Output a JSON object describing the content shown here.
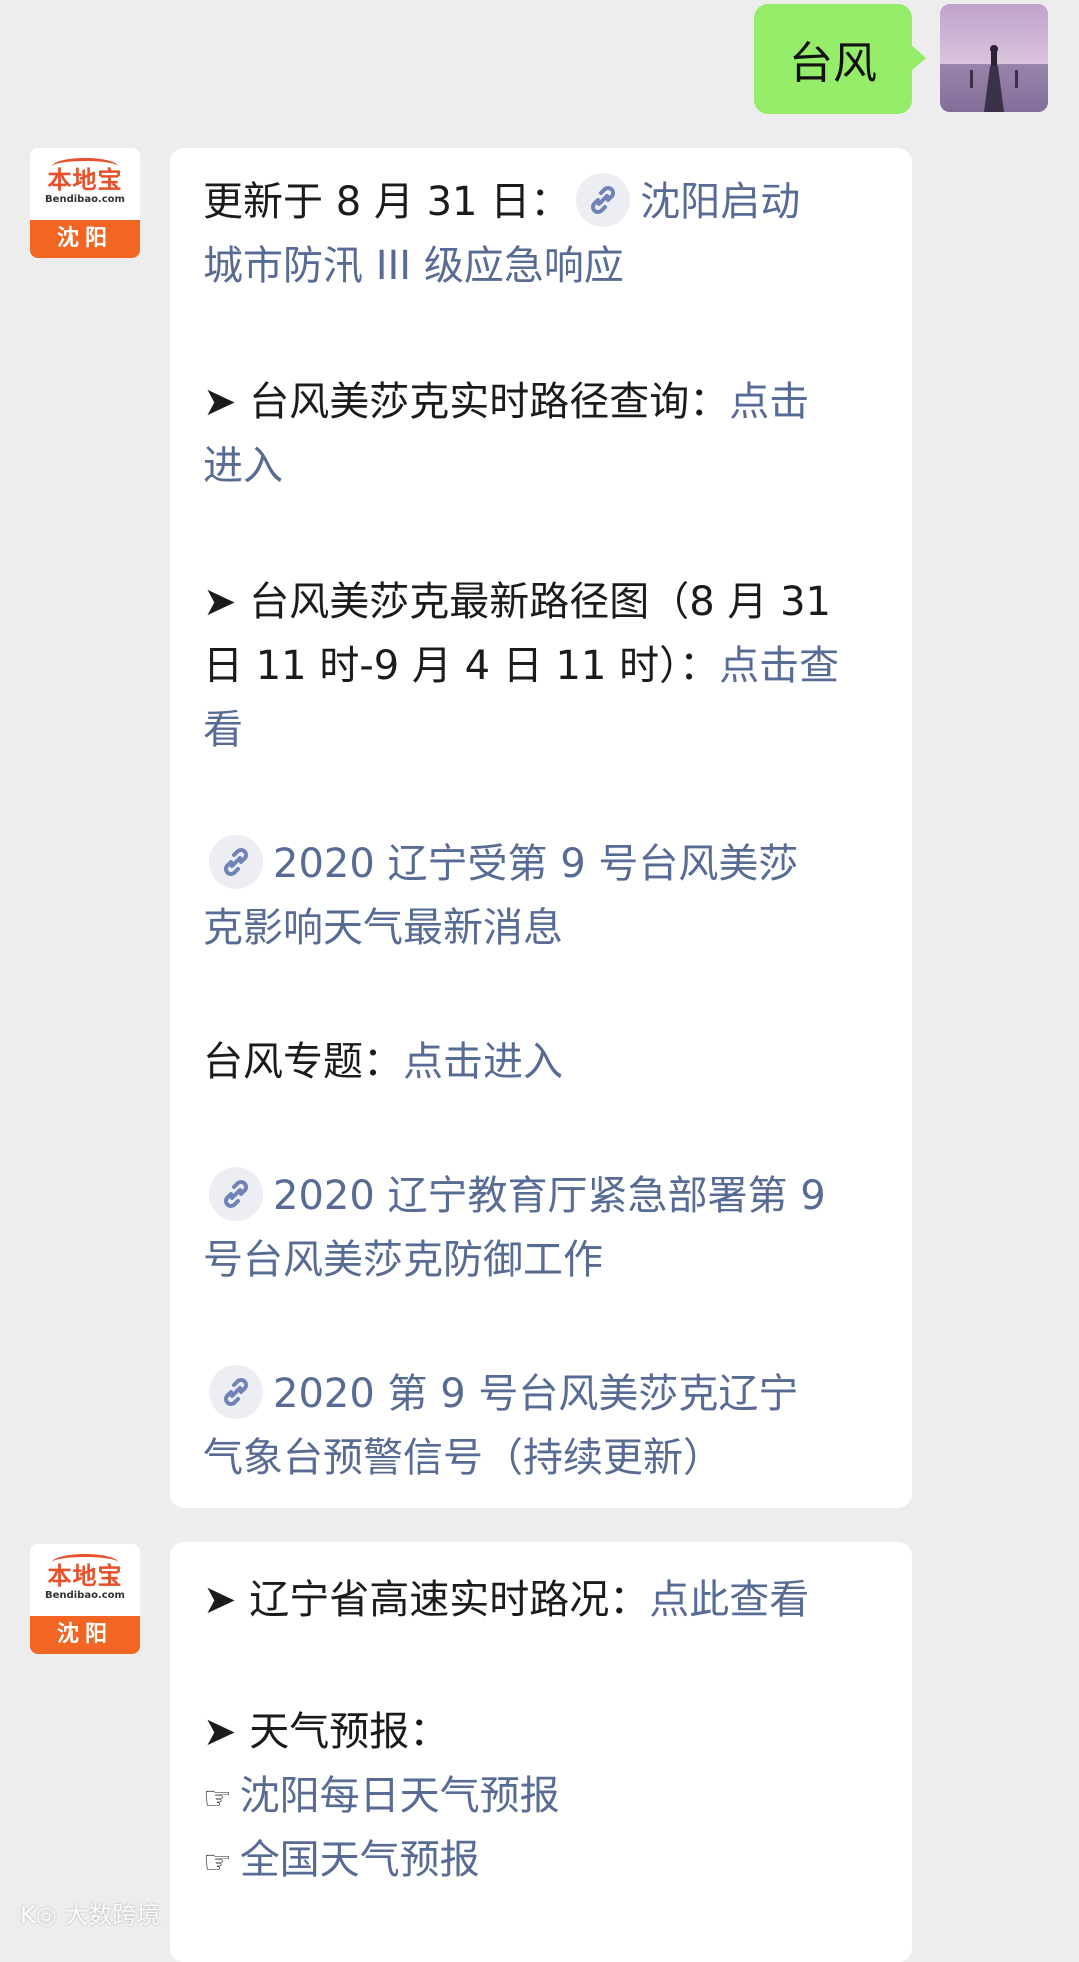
{
  "outgoing": {
    "text": "台风"
  },
  "brand_avatar": {
    "logo_text": "本地宝",
    "domain": "Bendibao.com",
    "city": "沈阳"
  },
  "message1": {
    "l1_prefix": "更新于 8 月 31 日：",
    "l1_link": "沈阳启动",
    "l2_link": "城市防汛 III 级应急响应",
    "l3_prefix": "➤ 台风美莎克实时路径查询：",
    "l3_link": "点击",
    "l4_link": "进入",
    "l5_text": "➤ 台风美莎克最新路径图（8 月 31",
    "l6_text": "日 11 时-9 月 4 日 11 时）：",
    "l6_link": "点击查",
    "l7_link": "看",
    "l8_link": "2020 辽宁受第 9 号台风美莎",
    "l9_link": "克影响天气最新消息",
    "l10_prefix": "台风专题：",
    "l10_link": "点击进入",
    "l11_link": "2020 辽宁教育厅紧急部署第 9",
    "l12_link": "号台风美莎克防御工作",
    "l13_link": "2020 第 9 号台风美莎克辽宁",
    "l14_link": "气象台预警信号（持续更新）"
  },
  "message2": {
    "l1_prefix": "➤ 辽宁省高速实时路况：",
    "l1_link": "点此查看",
    "l2_text": "➤ 天气预报：",
    "hand_glyph": "☞",
    "l3_link": "沈阳每日天气预报",
    "l4_link": "全国天气预报"
  },
  "watermark": {
    "text": "大数跨境"
  },
  "colors": {
    "link": "#576b95",
    "outgoing_bubble": "#95ec69",
    "brand_orange": "#f26522"
  }
}
